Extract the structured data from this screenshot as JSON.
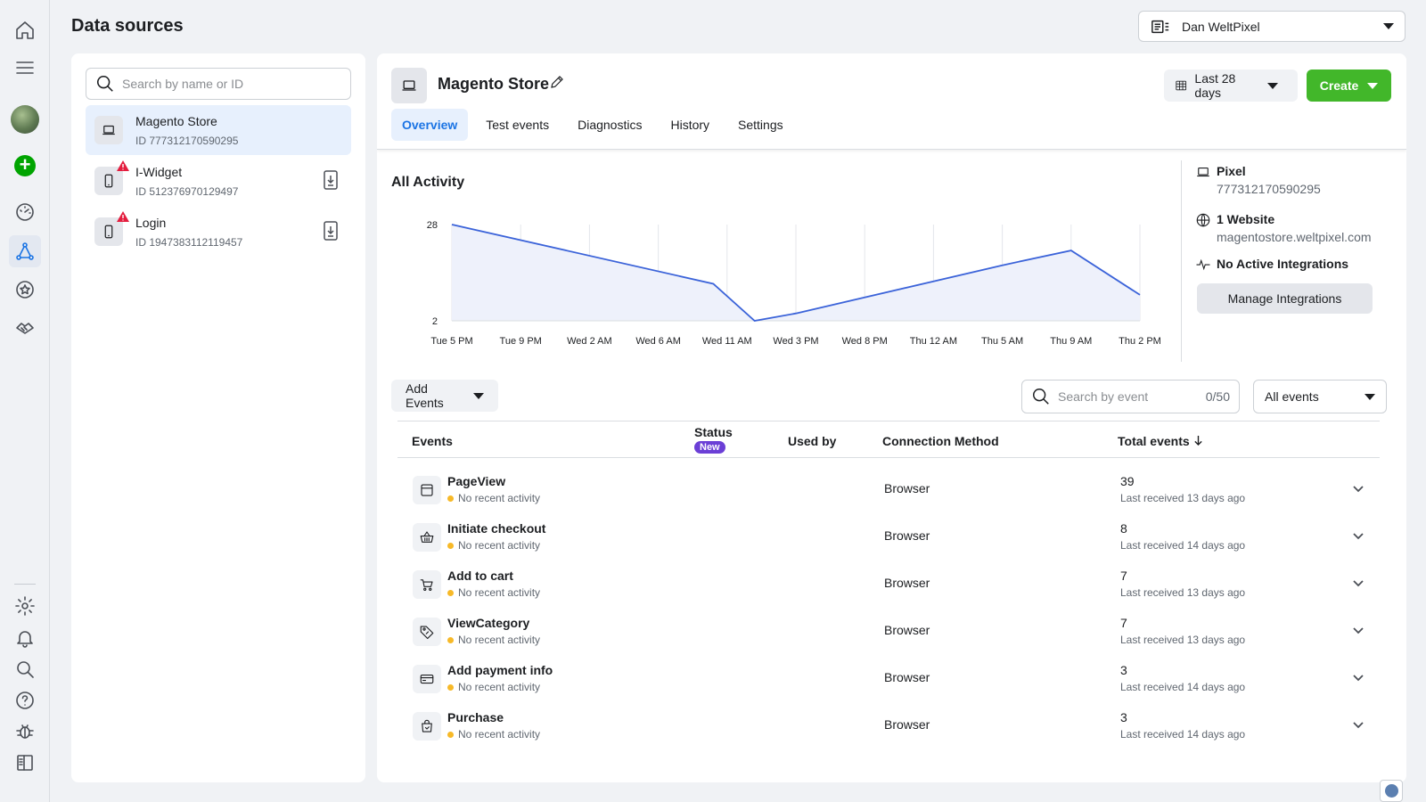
{
  "page": {
    "title": "Data sources"
  },
  "account": {
    "name": "Dan WeltPixel"
  },
  "search": {
    "placeholder": "Search by name or ID"
  },
  "sources": [
    {
      "name": "Magento Store",
      "id": "ID 777312170590295",
      "type": "laptop-icon",
      "selected": true
    },
    {
      "name": "I-Widget",
      "id": "ID 512376970129497",
      "type": "phone-icon",
      "warning": true
    },
    {
      "name": "Login",
      "id": "ID 1947383112119457",
      "type": "phone-icon",
      "warning": true
    }
  ],
  "detail": {
    "title": "Magento Store",
    "date_range": "Last 28 days",
    "create_label": "Create",
    "tabs": [
      "Overview",
      "Test events",
      "Diagnostics",
      "History",
      "Settings"
    ],
    "section_title": "All Activity",
    "pixel_label": "Pixel",
    "pixel_id": "777312170590295",
    "website_label": "1 Website",
    "website_url": "magentostore.weltpixel.com",
    "integrations_label": "No Active Integrations",
    "manage_label": "Manage Integrations"
  },
  "chart_data": {
    "type": "area",
    "x": [
      "Tue 5 PM",
      "Tue 9 PM",
      "Wed 2 AM",
      "Wed 6 AM",
      "Wed 11 AM",
      "Wed 3 PM",
      "Wed 8 PM",
      "Thu 12 AM",
      "Thu 5 AM",
      "Thu 9 AM",
      "Thu 2 PM"
    ],
    "y_ticks": [
      "28",
      "2"
    ],
    "ylim": [
      2,
      28
    ],
    "series": [
      {
        "points": [
          [
            0,
            28
          ],
          [
            3.8,
            12
          ],
          [
            4.4,
            2
          ],
          [
            5.0,
            4
          ],
          [
            8.0,
            17
          ],
          [
            9.0,
            21
          ],
          [
            10.0,
            9
          ]
        ]
      }
    ],
    "grid": true,
    "line_color": "#3b63d9",
    "fill_color": "#eef1fb"
  },
  "events_toolbar": {
    "add_label": "Add Events",
    "search_placeholder": "Search by event",
    "count": "0/50",
    "filter": "All events"
  },
  "table": {
    "headers": {
      "events": "Events",
      "status": "Status",
      "new_badge": "New",
      "used_by": "Used by",
      "method": "Connection Method",
      "total": "Total events"
    },
    "rows": [
      {
        "name": "PageView",
        "status": "No recent activity",
        "method": "Browser",
        "total": "39",
        "last": "Last received 13 days ago",
        "icon": "browser-window-icon"
      },
      {
        "name": "Initiate checkout",
        "status": "No recent activity",
        "method": "Browser",
        "total": "8",
        "last": "Last received 14 days ago",
        "icon": "basket-icon"
      },
      {
        "name": "Add to cart",
        "status": "No recent activity",
        "method": "Browser",
        "total": "7",
        "last": "Last received 13 days ago",
        "icon": "cart-icon"
      },
      {
        "name": "ViewCategory",
        "status": "No recent activity",
        "method": "Browser",
        "total": "7",
        "last": "Last received 13 days ago",
        "icon": "tag-icon"
      },
      {
        "name": "Add payment info",
        "status": "No recent activity",
        "method": "Browser",
        "total": "3",
        "last": "Last received 14 days ago",
        "icon": "credit-card-icon"
      },
      {
        "name": "Purchase",
        "status": "No recent activity",
        "method": "Browser",
        "total": "3",
        "last": "Last received 14 days ago",
        "icon": "shopping-bag-icon"
      }
    ]
  },
  "colors": {
    "accent": "#1b74e4",
    "create_green": "#42b72a",
    "status_dot": "#f7b928",
    "new_badge": "#6b3fd6",
    "warning": "#e41e3f"
  }
}
